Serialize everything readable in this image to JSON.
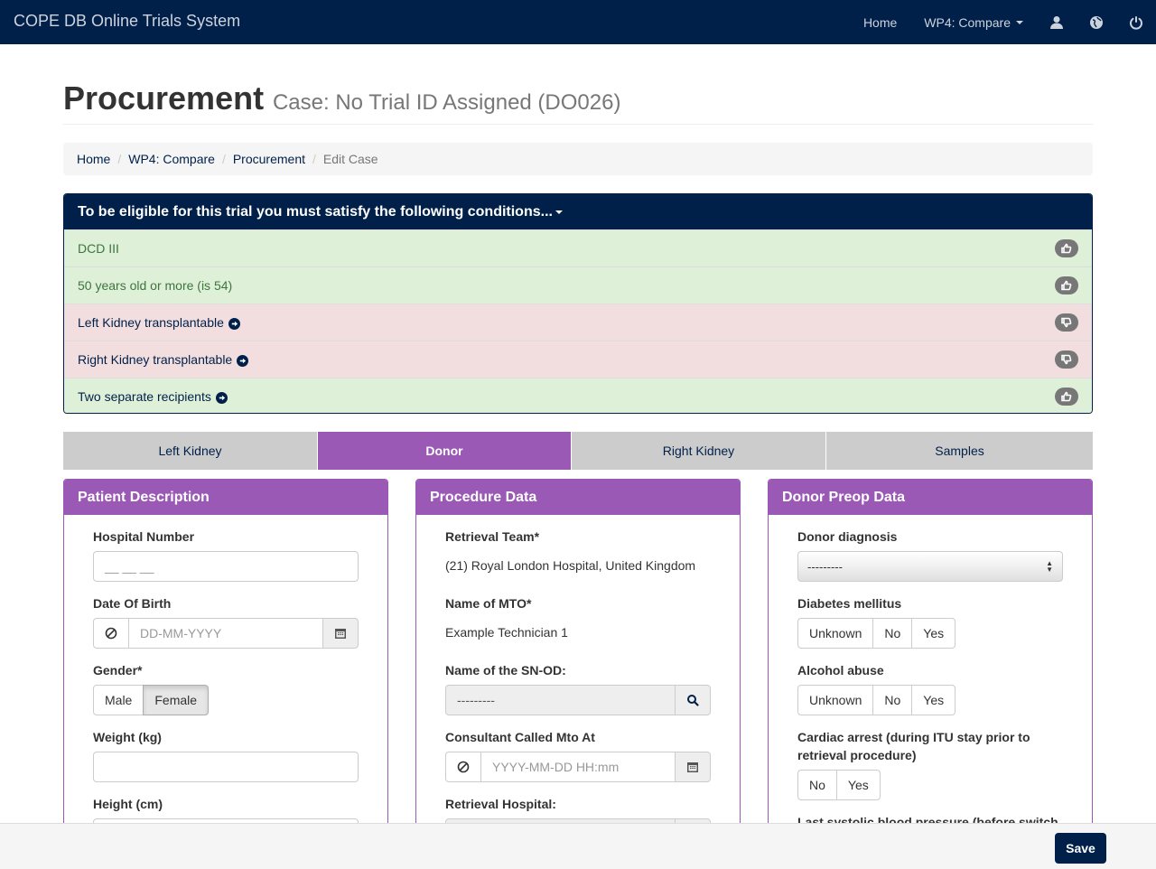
{
  "navbar": {
    "brand": "COPE DB Online Trials System",
    "home": "Home",
    "wp4": "WP4: Compare"
  },
  "header": {
    "title": "Procurement",
    "subtitle": "Case: No Trial ID Assigned (DO026)"
  },
  "breadcrumb": [
    "Home",
    "WP4: Compare",
    "Procurement",
    "Edit Case"
  ],
  "eligibility": {
    "heading": "To be eligible for this trial you must satisfy the following conditions...",
    "items": [
      {
        "label": "DCD III",
        "status": "pass"
      },
      {
        "label": "50 years old or more (is 54)",
        "status": "pass"
      },
      {
        "label": "Left Kidney transplantable",
        "status": "fail"
      },
      {
        "label": "Right Kidney transplantable",
        "status": "fail"
      },
      {
        "label": "Two separate recipients",
        "status": "pass"
      }
    ]
  },
  "tabs": [
    "Left Kidney",
    "Donor",
    "Right Kidney",
    "Samples"
  ],
  "patient": {
    "title": "Patient Description",
    "hospital_number_label": "Hospital Number",
    "hospital_number_placeholder": "__ __ __",
    "dob_label": "Date Of Birth",
    "dob_placeholder": "DD-MM-YYYY",
    "gender_label": "Gender*",
    "gender_male": "Male",
    "gender_female": "Female",
    "weight_label": "Weight (kg)",
    "height_label": "Height (cm)"
  },
  "procedure": {
    "title": "Procedure Data",
    "team_label": "Retrieval Team*",
    "team_value": "(21) Royal London Hospital, United Kingdom",
    "mto_label": "Name of MTO*",
    "mto_value": "Example Technician 1",
    "snod_label": "Name of the SN-OD:",
    "snod_value": "---------",
    "consultant_label": "Consultant Called Mto At",
    "consultant_placeholder": "YYYY-MM-DD HH:mm",
    "hospital_label": "Retrieval Hospital:"
  },
  "preop": {
    "title": "Donor Preop Data",
    "diagnosis_label": "Donor diagnosis",
    "diagnosis_value": "---------",
    "diabetes_label": "Diabetes mellitus",
    "alcohol_label": "Alcohol abuse",
    "unknown": "Unknown",
    "no": "No",
    "yes": "Yes",
    "cardiac_label": "Cardiac arrest (during ITU stay prior to retrieval procedure)",
    "systolic_label": "Last systolic blood pressure (before switch"
  },
  "footer": {
    "save": "Save"
  },
  "colors": {
    "navy": "#00204a",
    "purple": "#9b59b6",
    "success_bg": "#dff0d8",
    "danger_bg": "#f2dede"
  }
}
